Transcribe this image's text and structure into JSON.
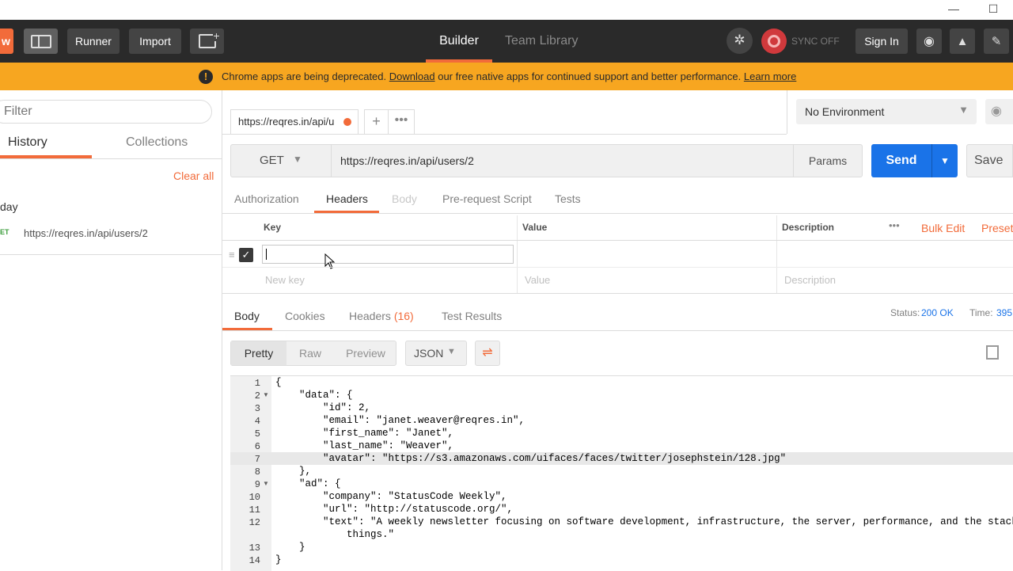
{
  "window": {
    "minimize": "—",
    "maximize": "☐"
  },
  "header": {
    "new_fragment": "w",
    "runner": "Runner",
    "import": "Import",
    "tabs": {
      "builder": "Builder",
      "team_library": "Team Library"
    },
    "sync": "SYNC OFF",
    "sign_in": "Sign In"
  },
  "banner": {
    "text_before": "Chrome apps are being deprecated.",
    "download_link": "Download",
    "text_middle": "our free native apps for continued support and better performance.",
    "learn_more": "Learn more"
  },
  "sidebar": {
    "filter_placeholder": "Filter",
    "tabs": {
      "history": "History",
      "collections": "Collections"
    },
    "clear_all": "Clear all",
    "group_label": "day",
    "items": [
      {
        "method": "ET",
        "url": "https://reqres.in/api/users/2"
      }
    ]
  },
  "request_tab": {
    "title": "https://reqres.in/api/u"
  },
  "environment": {
    "selected": "No Environment"
  },
  "request": {
    "method": "GET",
    "url": "https://reqres.in/api/users/2",
    "params": "Params",
    "send": "Send",
    "save": "Save"
  },
  "request_tabs": [
    "Authorization",
    "Headers",
    "Body",
    "Pre-request Script",
    "Tests"
  ],
  "headers_table": {
    "columns": {
      "key": "Key",
      "value": "Value",
      "description": "Description"
    },
    "bulk_edit": "Bulk Edit",
    "presets": "Preset",
    "new_row": {
      "key": "New key",
      "value": "Value",
      "description": "Description"
    }
  },
  "response": {
    "tabs": {
      "body": "Body",
      "cookies": "Cookies",
      "headers": "Headers",
      "headers_count": "(16)",
      "test_results": "Test Results"
    },
    "status_label": "Status:",
    "status_value": "200 OK",
    "time_label": "Time:",
    "time_value": "395",
    "views": {
      "pretty": "Pretty",
      "raw": "Raw",
      "preview": "Preview"
    },
    "format": "JSON"
  },
  "code": {
    "line_numbers": [
      "1",
      "2",
      "3",
      "4",
      "5",
      "6",
      "7",
      "8",
      "9",
      "10",
      "11",
      "12",
      "",
      "13",
      "14"
    ],
    "lines": [
      "{",
      "    \"data\": {",
      "        \"id\": 2,",
      "        \"email\": \"janet.weaver@reqres.in\",",
      "        \"first_name\": \"Janet\",",
      "        \"last_name\": \"Weaver\",",
      "        \"avatar\": \"https://s3.amazonaws.com/uifaces/faces/twitter/josephstein/128.jpg\"",
      "    },",
      "    \"ad\": {",
      "        \"company\": \"StatusCode Weekly\",",
      "        \"url\": \"http://statuscode.org/\",",
      "        \"text\": \"A weekly newsletter focusing on software development, infrastructure, the server, performance, and the stack end",
      "            things.\"",
      "    }",
      "}"
    ]
  },
  "colors": {
    "accent": "#f26b3a",
    "send": "#1a73e8",
    "banner": "#f7a620",
    "header": "#2a2a2a"
  }
}
